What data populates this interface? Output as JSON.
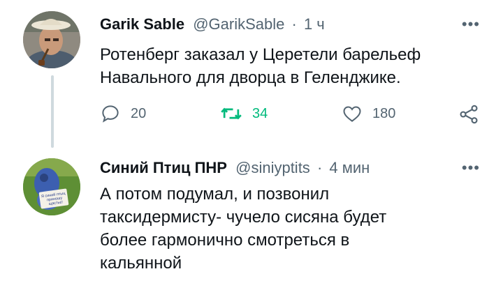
{
  "tweets": [
    {
      "author_name": "Garik Sable",
      "author_handle": "@GarikSable",
      "separator": "·",
      "time": "1 ч",
      "more_label": "•••",
      "text_lines": [
        "Ротенберг заказал у Церетели барельеф",
        "Навального для дворца в Геленджике."
      ],
      "replies": "20",
      "retweets": "34",
      "likes": "180"
    },
    {
      "author_name": "Синий Птиц ПНР",
      "author_handle": "@siniyptits",
      "separator": "·",
      "time": "4 мин",
      "more_label": "•••",
      "avatar_sign_text": [
        "Я синий птыц",
        "приношу",
        "щастье!"
      ],
      "text_lines": [
        "А потом подумал, и позвонил",
        "таксидермисту- чучело сисяна будет",
        "более гармонично смотреться в",
        "кальянной"
      ]
    }
  ],
  "colors": {
    "retweet_active": "#00ba7c",
    "muted": "#536471",
    "thread_line": "#cfd9de"
  }
}
